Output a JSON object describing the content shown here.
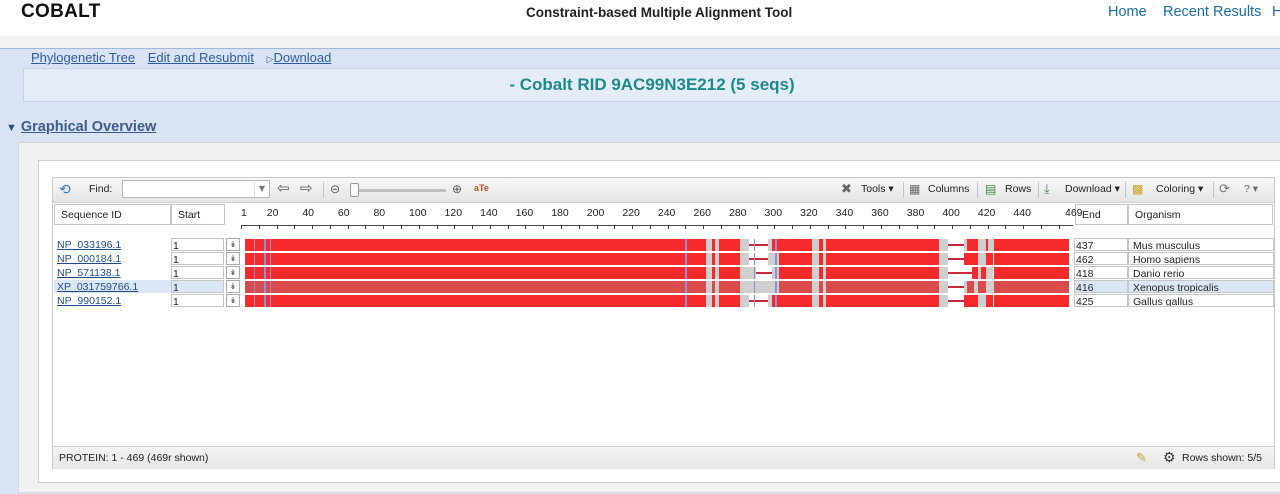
{
  "header": {
    "logo": "COBALT",
    "title": "Constraint-based Multiple Alignment Tool",
    "nav": [
      "Home",
      "Recent Results",
      "H"
    ]
  },
  "links": [
    "Phylogenetic Tree",
    "Edit and Resubmit",
    "Download"
  ],
  "page_title": "- Cobalt RID 9AC99N3E212 (5 seqs)",
  "section": {
    "label": "Graphical Overview"
  },
  "toolbar": {
    "find_label": "Find:",
    "find_value": "",
    "tools": "Tools",
    "columns": "Columns",
    "rows": "Rows",
    "download": "Download",
    "coloring": "Coloring"
  },
  "columns": {
    "seq_id": "Sequence ID",
    "start": "Start",
    "end": "End",
    "organism": "Organism"
  },
  "ruler_ticks": [
    "1",
    "20",
    "40",
    "60",
    "80",
    "100",
    "120",
    "140",
    "160",
    "180",
    "200",
    "220",
    "240",
    "260",
    "280",
    "300",
    "320",
    "340",
    "360",
    "380",
    "400",
    "420",
    "440",
    "469"
  ],
  "rows": [
    {
      "id": "NP_033196.1",
      "start": "1",
      "end": "437",
      "organism": "Mus musculus"
    },
    {
      "id": "NP_000184.1",
      "start": "1",
      "end": "462",
      "organism": "Homo sapiens"
    },
    {
      "id": "NP_571138.1",
      "start": "1",
      "end": "418",
      "organism": "Danio rerio"
    },
    {
      "id": "XP_031759766.1",
      "start": "1",
      "end": "416",
      "organism": "Xenopus tropicalis"
    },
    {
      "id": "NP_990152.1",
      "start": "1",
      "end": "425",
      "organism": "Gallus gallus"
    }
  ],
  "alignment": {
    "length": 469,
    "colors": {
      "conserved": "#f52a2a",
      "aligned_gray": "#cfcfcf",
      "insertion": "#c62a3c",
      "marker": "#8a8fe0",
      "selected_dim": "#d94b4b"
    },
    "blocks": [
      [
        [
          1,
          263,
          "r"
        ],
        [
          263,
          266,
          "g"
        ],
        [
          266,
          268,
          "r"
        ],
        [
          268,
          270,
          "g"
        ],
        [
          270,
          282,
          "r"
        ],
        [
          282,
          287,
          "g"
        ],
        [
          287,
          298,
          "l"
        ],
        [
          298,
          300,
          "g"
        ],
        [
          300,
          304,
          "r"
        ],
        [
          304,
          323,
          "r"
        ],
        [
          323,
          327,
          "g"
        ],
        [
          327,
          329,
          "r"
        ],
        [
          329,
          331,
          "g"
        ],
        [
          331,
          395,
          "r"
        ],
        [
          395,
          400,
          "g"
        ],
        [
          400,
          409,
          "l"
        ],
        [
          409,
          411,
          "g"
        ],
        [
          411,
          417,
          "r"
        ],
        [
          417,
          422,
          "g"
        ],
        [
          422,
          423,
          "r"
        ],
        [
          423,
          426,
          "g"
        ],
        [
          426,
          469,
          "r"
        ]
      ],
      [
        [
          1,
          263,
          "r"
        ],
        [
          263,
          266,
          "g"
        ],
        [
          266,
          268,
          "r"
        ],
        [
          268,
          270,
          "g"
        ],
        [
          270,
          282,
          "r"
        ],
        [
          282,
          287,
          "g"
        ],
        [
          287,
          298,
          "l"
        ],
        [
          298,
          304,
          "g"
        ],
        [
          304,
          323,
          "r"
        ],
        [
          323,
          327,
          "g"
        ],
        [
          327,
          329,
          "r"
        ],
        [
          329,
          331,
          "g"
        ],
        [
          331,
          395,
          "r"
        ],
        [
          395,
          400,
          "g"
        ],
        [
          400,
          409,
          "l"
        ],
        [
          409,
          417,
          "r"
        ],
        [
          417,
          422,
          "g"
        ],
        [
          422,
          426,
          "r"
        ],
        [
          426,
          469,
          "r"
        ]
      ],
      [
        [
          1,
          263,
          "r"
        ],
        [
          263,
          266,
          "g"
        ],
        [
          266,
          268,
          "r"
        ],
        [
          268,
          270,
          "g"
        ],
        [
          270,
          282,
          "r"
        ],
        [
          282,
          287,
          "g"
        ],
        [
          287,
          291,
          "g"
        ],
        [
          291,
          300,
          "l"
        ],
        [
          300,
          304,
          "g"
        ],
        [
          304,
          323,
          "r"
        ],
        [
          323,
          327,
          "g"
        ],
        [
          327,
          329,
          "r"
        ],
        [
          329,
          331,
          "g"
        ],
        [
          331,
          395,
          "r"
        ],
        [
          395,
          400,
          "g"
        ],
        [
          400,
          414,
          "l"
        ],
        [
          414,
          417,
          "r"
        ],
        [
          417,
          419,
          "g"
        ],
        [
          419,
          422,
          "r"
        ],
        [
          422,
          426,
          "g"
        ],
        [
          426,
          469,
          "r"
        ]
      ],
      [
        [
          1,
          263,
          "r"
        ],
        [
          263,
          266,
          "g"
        ],
        [
          266,
          268,
          "r"
        ],
        [
          268,
          270,
          "g"
        ],
        [
          270,
          282,
          "r"
        ],
        [
          282,
          287,
          "g"
        ],
        [
          287,
          298,
          "g"
        ],
        [
          298,
          304,
          "g"
        ],
        [
          304,
          323,
          "r"
        ],
        [
          323,
          327,
          "g"
        ],
        [
          327,
          329,
          "r"
        ],
        [
          329,
          331,
          "g"
        ],
        [
          331,
          395,
          "r"
        ],
        [
          395,
          400,
          "g"
        ],
        [
          400,
          409,
          "l"
        ],
        [
          409,
          411,
          "g"
        ],
        [
          411,
          415,
          "r"
        ],
        [
          415,
          417,
          "g"
        ],
        [
          417,
          422,
          "r"
        ],
        [
          422,
          424,
          "g"
        ],
        [
          424,
          426,
          "g"
        ],
        [
          426,
          469,
          "r"
        ]
      ],
      [
        [
          1,
          263,
          "r"
        ],
        [
          263,
          266,
          "g"
        ],
        [
          266,
          268,
          "r"
        ],
        [
          268,
          270,
          "g"
        ],
        [
          270,
          282,
          "r"
        ],
        [
          282,
          287,
          "g"
        ],
        [
          287,
          298,
          "l"
        ],
        [
          298,
          300,
          "g"
        ],
        [
          300,
          304,
          "r"
        ],
        [
          304,
          323,
          "r"
        ],
        [
          323,
          327,
          "g"
        ],
        [
          327,
          329,
          "r"
        ],
        [
          329,
          331,
          "g"
        ],
        [
          331,
          395,
          "r"
        ],
        [
          395,
          400,
          "g"
        ],
        [
          400,
          409,
          "l"
        ],
        [
          409,
          417,
          "r"
        ],
        [
          417,
          422,
          "g"
        ],
        [
          422,
          426,
          "r"
        ],
        [
          426,
          469,
          "r"
        ]
      ]
    ],
    "markers": [
      6,
      12,
      15,
      251,
      290,
      302
    ]
  },
  "status": {
    "left": "PROTEIN: 1 - 469 (469r shown)",
    "rows_shown": "Rows shown: 5/5"
  },
  "icons": [
    "undo-icon",
    "left-arrow-icon",
    "right-arrow-icon",
    "zoom-out-icon",
    "zoom-in-icon",
    "fit-icon",
    "tools-icon",
    "columns-icon",
    "rows-icon",
    "download-icon",
    "coloring-icon",
    "refresh-icon",
    "help-icon",
    "wand-icon",
    "gear-icon"
  ]
}
